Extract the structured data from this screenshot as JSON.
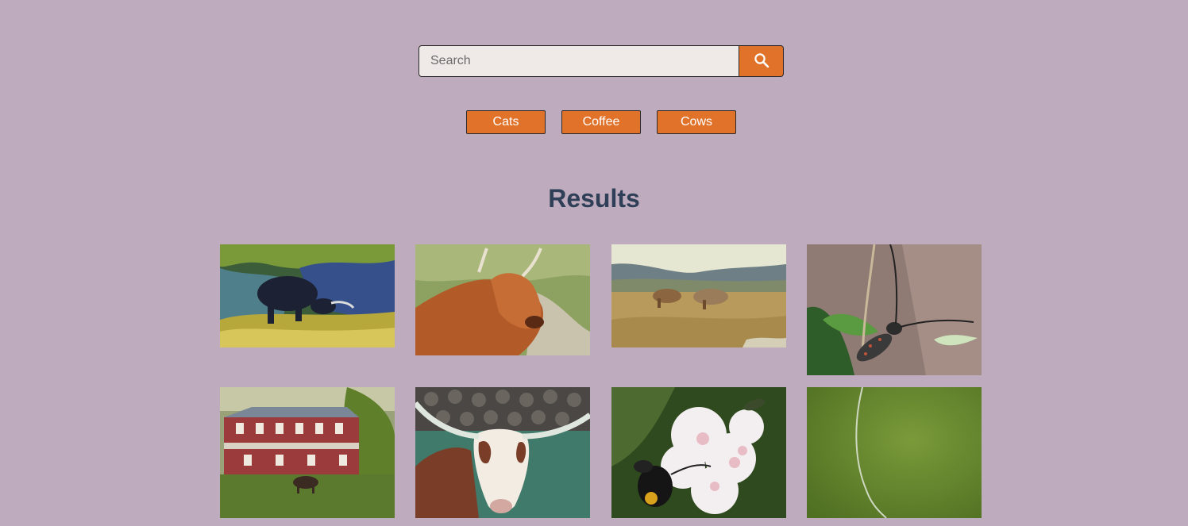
{
  "search": {
    "placeholder": "Search",
    "value": "",
    "button_icon": "search-icon",
    "accent_color": "#e07229"
  },
  "tags": [
    "Cats",
    "Coffee",
    "Cows"
  ],
  "results": {
    "title": "Results",
    "images": [
      {
        "subject": "black cow grazing on rocky hillside"
      },
      {
        "subject": "highland cow with long horns"
      },
      {
        "subject": "two longhorn cattle in grassland with mountains"
      },
      {
        "subject": "longhorn beetle on plant stem"
      },
      {
        "subject": "red farmhouse with cow in pasture"
      },
      {
        "subject": "texas longhorn cow in front of stone wall"
      },
      {
        "subject": "bee on white flowers"
      },
      {
        "subject": "green stem on blurred background"
      }
    ]
  },
  "colors": {
    "background": "#bfabbe",
    "title": "#2e3f57",
    "button": "#e07229"
  }
}
